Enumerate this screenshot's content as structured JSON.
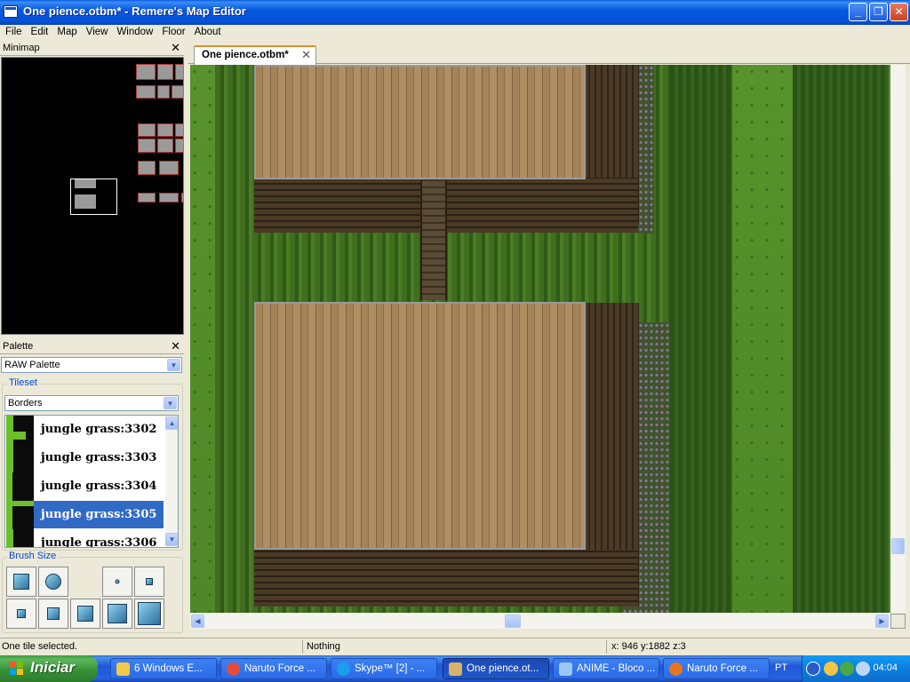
{
  "window": {
    "title": "One pience.otbm* - Remere's Map Editor"
  },
  "menu": [
    "File",
    "Edit",
    "Map",
    "View",
    "Window",
    "Floor",
    "About"
  ],
  "minimap": {
    "title": "Minimap",
    "close": "✕"
  },
  "palette": {
    "title": "Palette",
    "close": "✕",
    "selected_palette": "RAW Palette",
    "tileset_label": "Tileset",
    "tileset_value": "Borders",
    "items": [
      {
        "label": "jungle grass:3302",
        "selected": false
      },
      {
        "label": "jungle grass:3303",
        "selected": false
      },
      {
        "label": "jungle grass:3304",
        "selected": false
      },
      {
        "label": "jungle grass:3305",
        "selected": true
      },
      {
        "label": "jungle grass:3306",
        "selected": false
      }
    ],
    "brush_size_label": "Brush Size"
  },
  "map_tab": {
    "label": "One pience.otbm*",
    "close": "✕"
  },
  "statusbar": {
    "selection": "One tile selected.",
    "item": "Nothing",
    "position": "x: 946 y:1882 z:3"
  },
  "taskbar": {
    "start_label": "Iniciar",
    "tasks": [
      {
        "label": "6 Windows E...",
        "icon": "folder-icon",
        "color": "#f3c94a"
      },
      {
        "label": "Naruto Force ...",
        "icon": "chrome-icon",
        "color": "#e44b3a"
      },
      {
        "label": "Skype™ [2] - ...",
        "icon": "skype-icon",
        "color": "#1aa0e8"
      },
      {
        "label": "One pience.ot...",
        "icon": "map-editor-icon",
        "color": "#d9b36a",
        "active": true
      },
      {
        "label": "ANIME - Bloco ...",
        "icon": "notepad-icon",
        "color": "#9cc7f2"
      },
      {
        "label": "Naruto Force ...",
        "icon": "firefox-icon",
        "color": "#e8761e"
      }
    ],
    "language": "PT",
    "clock": "04:04"
  }
}
